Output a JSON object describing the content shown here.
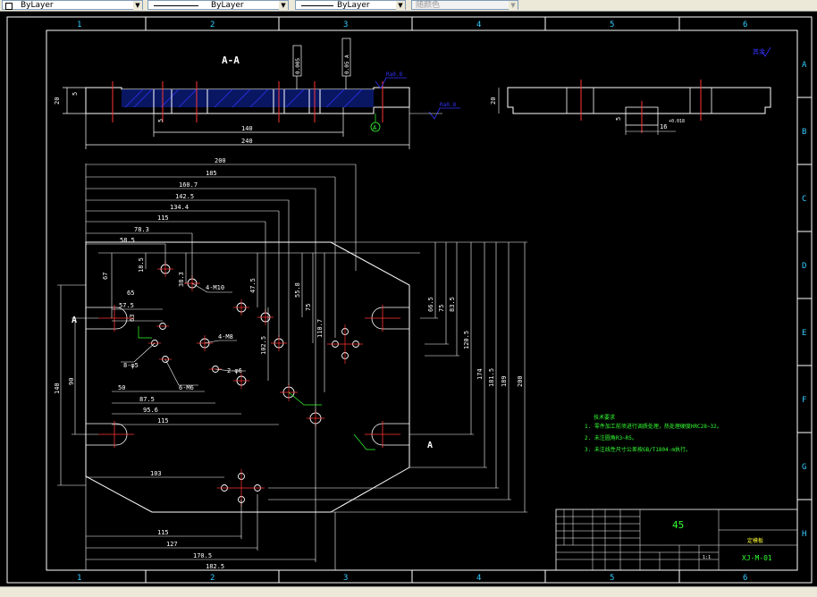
{
  "toolbar": {
    "layer_color": "ByLayer",
    "linetype": "ByLayer",
    "lineweight": "ByLayer",
    "plot_style": "随颜色"
  },
  "drawing": {
    "border_columns": [
      "1",
      "2",
      "3",
      "4",
      "5",
      "6"
    ],
    "border_rows": [
      "A",
      "B",
      "C",
      "D",
      "E",
      "F",
      "G",
      "H"
    ],
    "section_label": "A-A",
    "section_mark_left": "A",
    "section_mark_right": "A",
    "datum_a": "A",
    "roughness_note": "其余",
    "tolerance_1": "0.005",
    "tolerance_2": "0.05 A",
    "surface_1": "Ra0.8",
    "surface_2": "Ra0.8",
    "dims_section": [
      "20",
      "5",
      "5",
      "140",
      "240"
    ],
    "dims_side": [
      "20",
      "5",
      "16"
    ],
    "side_tol": "+0.018",
    "dims_top": [
      "200",
      "185",
      "160.7",
      "142.5",
      "134.4",
      "115",
      "78.3",
      "58.5"
    ],
    "dims_right": [
      "66.5",
      "75",
      "83.5",
      "120.5",
      "174",
      "181.5",
      "189",
      "200"
    ],
    "dims_inner_v": [
      "67",
      "18.5",
      "38.3",
      "47.5",
      "55.8",
      "75",
      "110.7",
      "102.5"
    ],
    "dims_left": [
      "140",
      "90"
    ],
    "dims_inner_h": [
      "57.5",
      "65",
      "63",
      "50",
      "87.5",
      "95.6",
      "115"
    ],
    "dims_bottom": [
      "103",
      "115",
      "127",
      "170.5",
      "182.5"
    ],
    "hole_labels": [
      "4-M10",
      "4-M8",
      "8-φ5",
      "2-φ6",
      "6-M6"
    ],
    "notes_title": "技术要求",
    "notes": [
      "1. 零件加工前须进行调质处理，热处理硬度HRC28~32。",
      "2. 未注圆角R3~R5。",
      "3. 未注线性尺寸公差按GB/T1804-m执行。"
    ],
    "title_block": {
      "material": "45",
      "part_name": "定模板",
      "drawing_no": "XJ-M-01",
      "scale": "1:1"
    }
  }
}
